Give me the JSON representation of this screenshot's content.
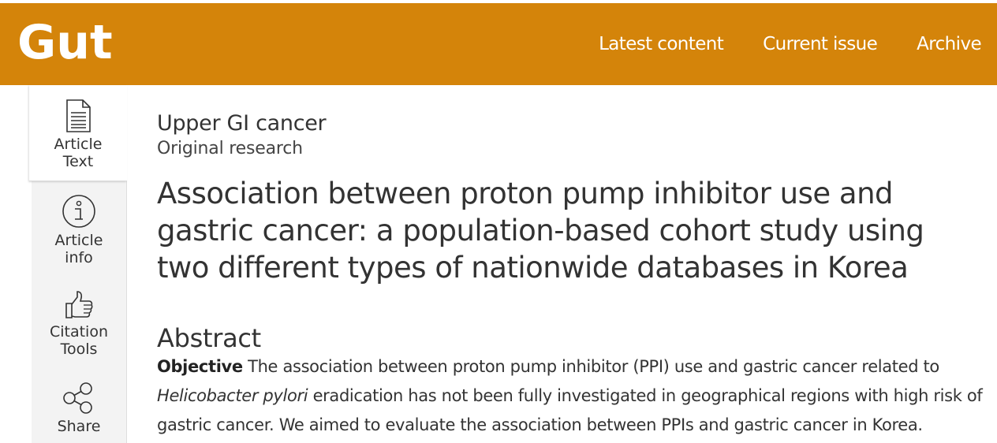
{
  "header": {
    "logo": "Gut",
    "brand_color": "#D4840A",
    "nav": [
      "Latest content",
      "Current issue",
      "Archive"
    ]
  },
  "sidebar": {
    "items": [
      {
        "label_line1": "Article",
        "label_line2": "Text",
        "icon": "document-icon",
        "active": true
      },
      {
        "label_line1": "Article",
        "label_line2": "info",
        "icon": "info-icon",
        "active": false
      },
      {
        "label_line1": "Citation",
        "label_line2": "Tools",
        "icon": "thumbs-up-icon",
        "active": false
      },
      {
        "label_line1": "Share",
        "label_line2": "",
        "icon": "share-icon",
        "active": false
      }
    ]
  },
  "article": {
    "section": "Upper GI cancer",
    "type": "Original research",
    "title": "Association between proton pump inhibitor use and gastric cancer: a population-based cohort study using two different types of nationwide databases in Korea",
    "abstract_heading": "Abstract",
    "abstract": {
      "label": "Objective",
      "text_part1": " The association between proton pump inhibitor (PPI) use and gastric cancer related to ",
      "italic": "Helicobacter pylori",
      "text_part2": " eradication has not been fully investigated in geographical regions with high risk of gastric cancer. We aimed to evaluate the association between PPIs and gastric cancer in Korea."
    }
  }
}
